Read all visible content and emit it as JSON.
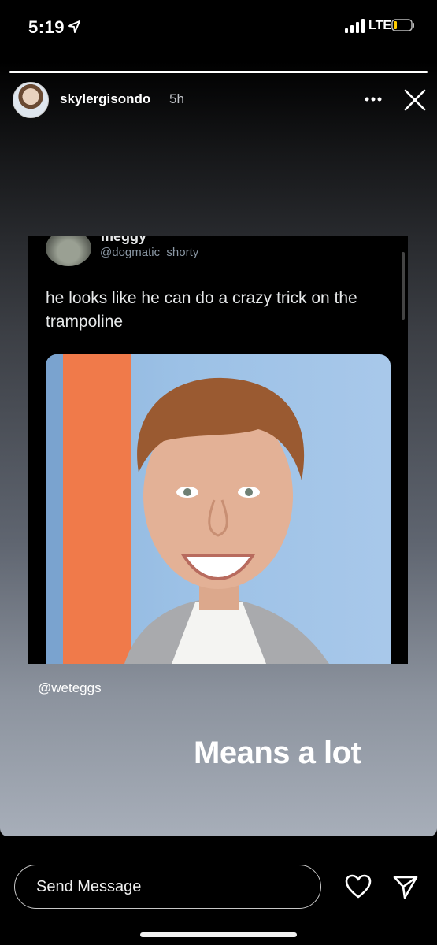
{
  "status_bar": {
    "time": "5:19",
    "network": "LTE",
    "location_icon": "location-arrow-icon",
    "signal_icon": "signal-bars-icon",
    "battery_icon": "battery-low-icon",
    "battery_level": 0.12
  },
  "story": {
    "progress": 1.0,
    "username": "skylergisondo",
    "time_ago": "5h",
    "more_icon": "more-options-icon",
    "close_icon": "close-icon"
  },
  "tweet": {
    "display_name": "meggy",
    "handle": "@dogmatic_shorty",
    "text": "he looks like he can do a crazy trick on the trampoline"
  },
  "mention": "@weteggs",
  "caption": "Means a lot",
  "footer": {
    "send_placeholder": "Send Message",
    "heart_icon": "heart-icon",
    "share_icon": "direct-share-icon"
  },
  "colors": {
    "accent_orange": "#f07a4a",
    "photo_background": "#9cc1e6"
  }
}
